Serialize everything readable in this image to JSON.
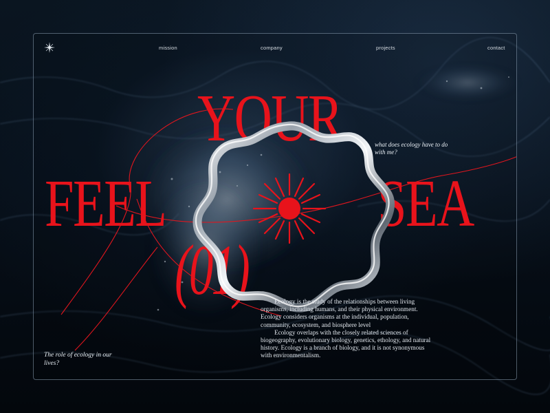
{
  "nav": {
    "logo_icon": "star-sparkle-icon",
    "items": [
      {
        "label": "mission"
      },
      {
        "label": "company"
      },
      {
        "label": "projects"
      },
      {
        "label": "contact"
      }
    ]
  },
  "hero": {
    "word_top": "YOUR",
    "word_left": "FEEL",
    "word_right": "SEA",
    "number": "(01)",
    "accent_color": "#e8131b"
  },
  "question_top": "what does ecology have to do with me?",
  "question_left": "The role of ecology in our lives?",
  "body": {
    "paragraph_1": "Ecology is the study of the relationships between living organisms, including humans, and their physical environment. Ecology considers organisms at the individual, population, community, ecosystem, and biosphere level",
    "paragraph_2": "Ecology overlaps with the closely related sciences of biogeography, evolutionary biology, genetics, ethology, and natural history. Ecology is a branch of biology, and it is not synonymous with environmentalism."
  },
  "decor": {
    "ring_icon": "chrome-wavy-ring",
    "sun_icon": "red-sunburst-icon"
  }
}
